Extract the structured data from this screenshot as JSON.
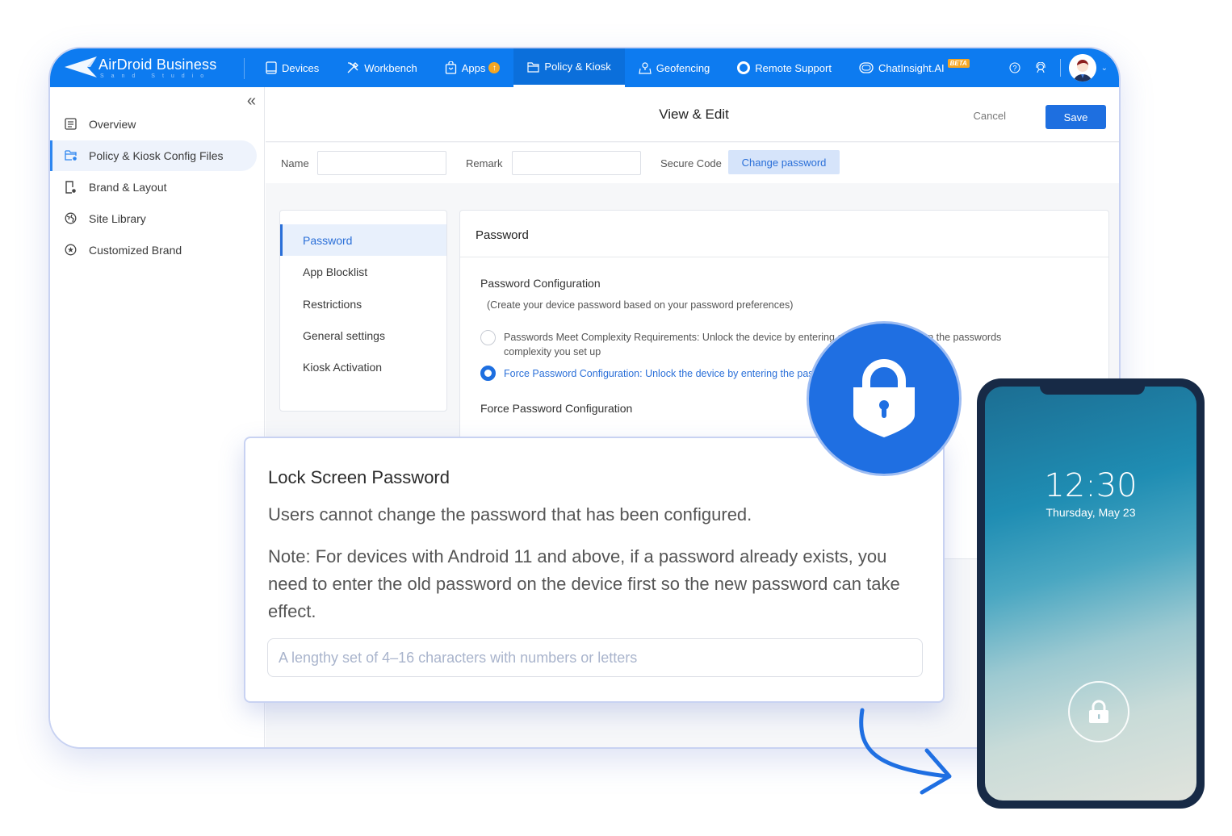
{
  "app": {
    "brand": "AirDroid Business",
    "brand_sub": "Sand Studio"
  },
  "nav": {
    "items": [
      {
        "label": "Devices",
        "icon": "tablet-icon"
      },
      {
        "label": "Workbench",
        "icon": "tools-icon"
      },
      {
        "label": "Apps",
        "icon": "bag-icon",
        "badge": "update-badge"
      },
      {
        "label": "Policy & Kiosk",
        "icon": "folder-icon",
        "active": true
      },
      {
        "label": "Geofencing",
        "icon": "map-pin-icon"
      },
      {
        "label": "Remote Support",
        "icon": "lifebuoy-icon"
      },
      {
        "label": "ChatInsight.AI",
        "icon": "chat-bot-icon",
        "tag": "BETA"
      }
    ],
    "right_icons": [
      "help-icon",
      "support-agent-icon"
    ],
    "accent": "#0d7bf0"
  },
  "sidebar": {
    "collapse_glyph": "«",
    "items": [
      {
        "label": "Overview",
        "icon": "document-icon"
      },
      {
        "label": "Policy & Kiosk Config Files",
        "icon": "folder-gear-icon",
        "active": true
      },
      {
        "label": "Brand & Layout",
        "icon": "device-gear-icon"
      },
      {
        "label": "Site Library",
        "icon": "globe-icon"
      },
      {
        "label": "Customized Brand",
        "icon": "star-circle-icon"
      }
    ]
  },
  "header": {
    "title": "View & Edit",
    "cancel": "Cancel",
    "save": "Save"
  },
  "form": {
    "name_label": "Name",
    "name_value": "",
    "remark_label": "Remark",
    "remark_value": "",
    "secure_code_label": "Secure Code",
    "change_password": "Change password"
  },
  "tabs": [
    {
      "label": "Password",
      "active": true
    },
    {
      "label": "App Blocklist"
    },
    {
      "label": "Restrictions"
    },
    {
      "label": "General settings"
    },
    {
      "label": "Kiosk Activation"
    }
  ],
  "password_panel": {
    "title": "Password",
    "config_title": "Password Configuration",
    "config_sub": "(Create your device password based on your password preferences)",
    "option1_line1": "Passwords Meet Complexity Requirements:  Unlock the device by entering a password based on the passwords",
    "option1_line2": "complexity you set up",
    "option2": "Force Password Configuration: Unlock the device by entering the password you set",
    "selected_option": 2,
    "force_title": "Force Password Configuration"
  },
  "popup": {
    "title": "Lock Screen Password",
    "line": "Users cannot change the password that has been configured.",
    "note": "Note: For devices with Android 11 and above, if a password already exists, you need to enter the old password on the device first so the new password can take effect.",
    "input_value": "",
    "input_placeholder": "A lengthy set of 4–16 characters with numbers or letters"
  },
  "phone": {
    "time": "12:30",
    "date": "Thursday, May 23"
  }
}
